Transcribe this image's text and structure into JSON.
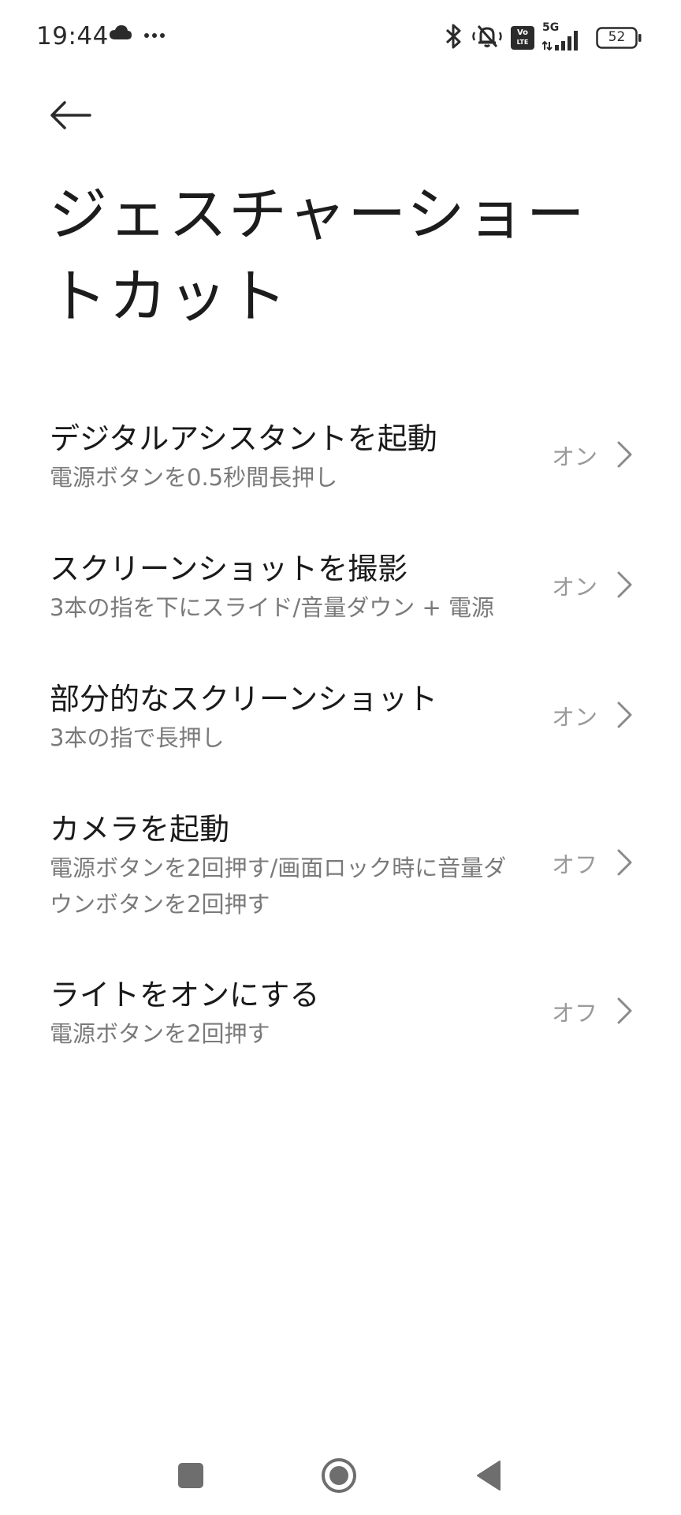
{
  "status_bar": {
    "time": "19:44",
    "battery_level": "52",
    "network": "5G",
    "volte_top": "Vo",
    "volte_bottom": "LTE",
    "icons": [
      "cloud-icon",
      "more-dots-icon",
      "bluetooth-icon",
      "vibrate-silent-icon",
      "volte-icon",
      "signal-icon",
      "battery-icon"
    ]
  },
  "header": {
    "back_icon": "back-arrow-icon",
    "title": "ジェスチャーショートカット"
  },
  "settings": [
    {
      "title": "デジタルアシスタントを起動",
      "subtitle": "電源ボタンを0.5秒間長押し",
      "status": "オン"
    },
    {
      "title": "スクリーンショットを撮影",
      "subtitle": "3本の指を下にスライド/音量ダウン + 電源",
      "status": "オン"
    },
    {
      "title": "部分的なスクリーンショット",
      "subtitle": "3本の指で長押し",
      "status": "オン"
    },
    {
      "title": "カメラを起動",
      "subtitle": "電源ボタンを2回押す/画面ロック時に音量ダウンボタンを2回押す",
      "status": "オフ"
    },
    {
      "title": "ライトをオンにする",
      "subtitle": "電源ボタンを2回押す",
      "status": "オフ"
    }
  ],
  "nav_bar": {
    "icons": [
      "recents-square-icon",
      "home-circle-icon",
      "back-triangle-icon"
    ]
  },
  "colors": {
    "background": "#ffffff",
    "title_text": "#1a1a1a",
    "subtitle_text": "#7a7a7a",
    "status_text": "#9a9a9a",
    "nav_icons": "#6e6e6e"
  }
}
